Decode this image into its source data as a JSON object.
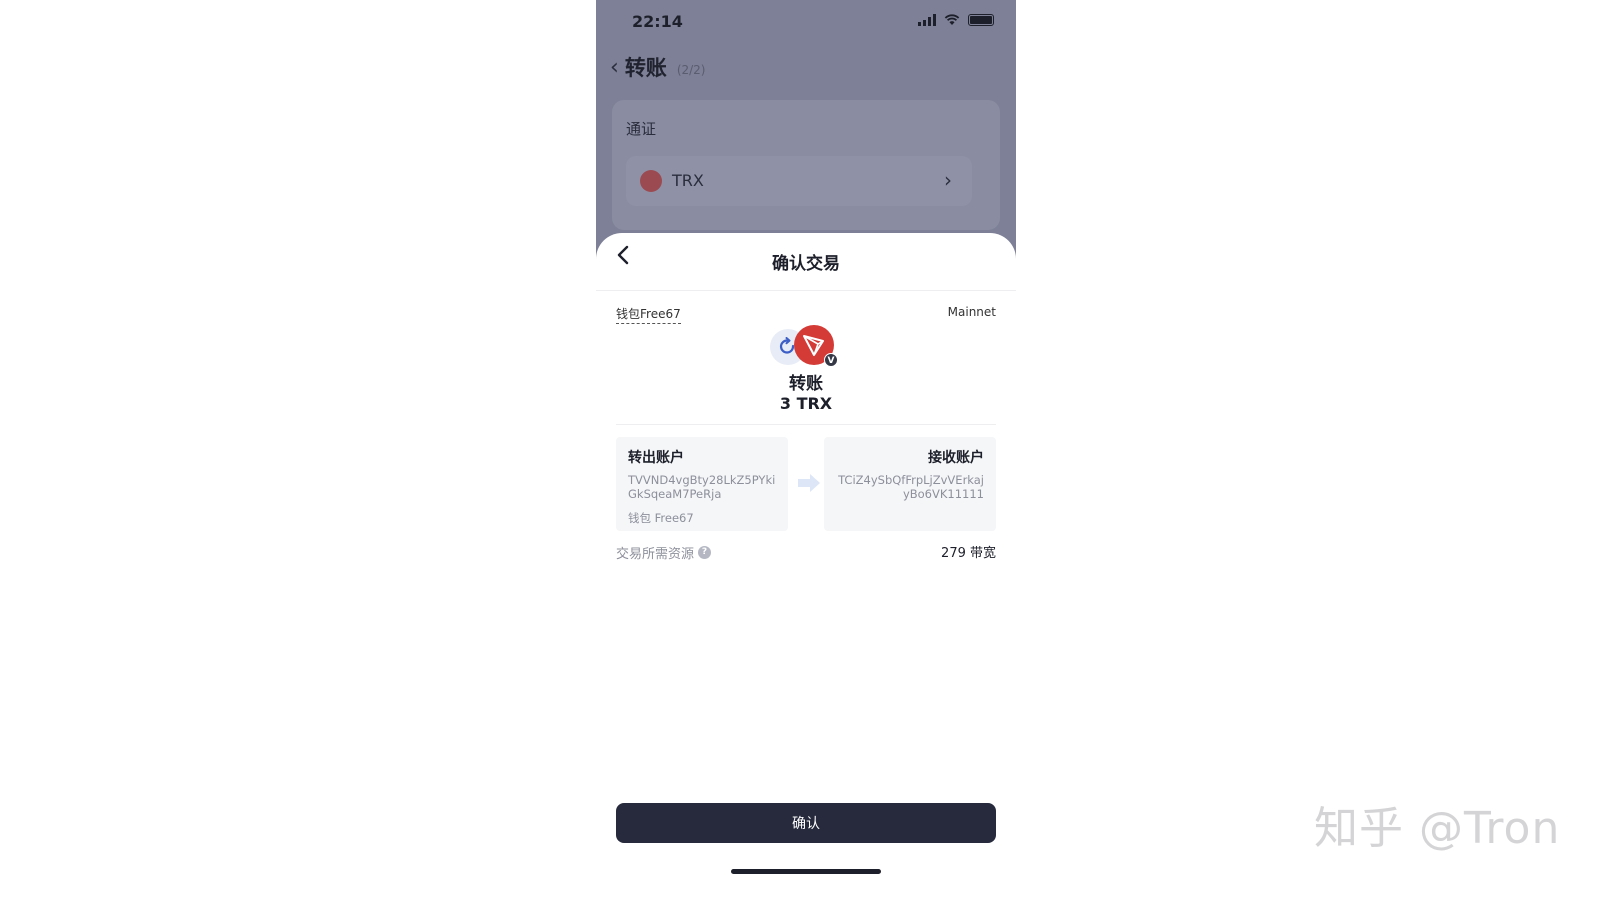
{
  "status_bar": {
    "time": "22:14"
  },
  "background_page": {
    "title": "转账",
    "step": "(2/2)",
    "token_section_label": "通证",
    "token_name": "TRX"
  },
  "sheet": {
    "title": "确认交易",
    "wallet_name": "钱包Free67",
    "network": "Mainnet",
    "action_title": "转账",
    "amount": "3 TRX",
    "from_account": {
      "label": "转出账户",
      "address": "TVVND4vgBty28LkZ5PYkiGkSqeaM7PeRja",
      "wallet": "钱包 Free67"
    },
    "to_account": {
      "label": "接收账户",
      "address": "TCiZ4ySbQfFrpLjZvVErkajyBo6VK11111"
    },
    "resource_label": "交易所需资源",
    "resource_value": "279 带宽",
    "badge_letter": "V",
    "confirm_label": "确认"
  },
  "watermark": "知乎 @Tron",
  "colors": {
    "dim_overlay": "#7d8096",
    "trx_red": "#d43a36",
    "button_dark": "#262a3c"
  }
}
